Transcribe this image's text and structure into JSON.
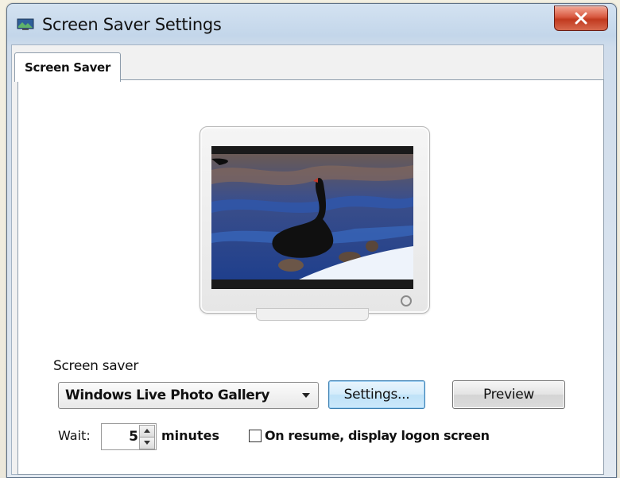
{
  "window": {
    "title": "Screen Saver Settings",
    "close_glyph": "x"
  },
  "tabs": [
    {
      "label": "Screen Saver",
      "active": true
    }
  ],
  "screen_saver": {
    "group_label": "Screen saver",
    "selected": "Windows Live Photo Gallery",
    "settings_button": "Settings...",
    "preview_button": "Preview"
  },
  "wait": {
    "label": "Wait:",
    "value": "5",
    "unit": "minutes"
  },
  "resume": {
    "label": "On resume, display logon screen",
    "checked": false
  },
  "colors": {
    "title_bar": "#c3d6ea",
    "close_button": "#d8583f",
    "settings_focus": "#3c7fb1"
  },
  "icons": [
    "app-icon",
    "close-icon",
    "dropdown-arrow-icon",
    "spin-up-icon",
    "spin-down-icon"
  ]
}
